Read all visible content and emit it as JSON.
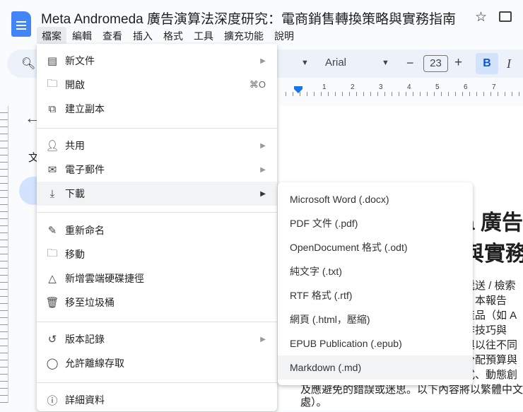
{
  "doc_title": "Meta Andromeda 廣告演算法深度研究：電商銷售轉換策略與實務指南",
  "menubar": [
    "檔案",
    "編輯",
    "查看",
    "插入",
    "格式",
    "工具",
    "擴充功能",
    "說明"
  ],
  "toolbar": {
    "font": "Arial",
    "font_size": "23",
    "bold": "B",
    "italic": "I",
    "minus": "−",
    "plus": "+"
  },
  "ruler_ticks": [
    "1",
    "2",
    "3",
    "4",
    "5",
    "6",
    "7"
  ],
  "sidebar": {
    "char": "文"
  },
  "file_menu": [
    {
      "label": "新文件",
      "icon": "document-icon",
      "arrow": "▶"
    },
    {
      "label": "開啟",
      "icon": "folder-icon",
      "shortcut": "⌘O"
    },
    {
      "label": "建立副本",
      "icon": "copy-icon"
    },
    {
      "label": "共用",
      "icon": "person-add-icon",
      "arrow": "▶"
    },
    {
      "label": "電子郵件",
      "icon": "mail-icon",
      "arrow": "▶"
    },
    {
      "label": "下載",
      "icon": "download-icon",
      "arrow": "▶"
    },
    {
      "label": "重新命名",
      "icon": "pencil-icon"
    },
    {
      "label": "移動",
      "icon": "move-folder-icon"
    },
    {
      "label": "新增雲端硬碟捷徑",
      "icon": "drive-shortcut-icon"
    },
    {
      "label": "移至垃圾桶",
      "icon": "trash-icon"
    },
    {
      "label": "版本記錄",
      "icon": "history-icon",
      "arrow": "▶"
    },
    {
      "label": "允許離線存取",
      "icon": "offline-icon"
    },
    {
      "label": "詳細資料",
      "icon": "info-icon"
    }
  ],
  "download_submenu": [
    "Microsoft Word (.docx)",
    "PDF 文件 (.pdf)",
    "OpenDocument 格式 (.odt)",
    "純文字 (.txt)",
    "RTF 格式 (.rtf)",
    "網頁 (.html，壓縮)",
    "EPUB Publication (.epub)",
    "Markdown (.md)"
  ],
  "document": {
    "heading": [
      "a 廣告",
      "與實務"
    ],
    "body": [
      "遞送 / 檢索",
      "。本報告",
      "產品（如 A",
      "作技巧與",
      "與以往不同",
      "分配預算與",
      "式、動態創",
      "及應避免的錯誤或迷思。以下內容將以繁體中文",
      "處）。"
    ]
  }
}
